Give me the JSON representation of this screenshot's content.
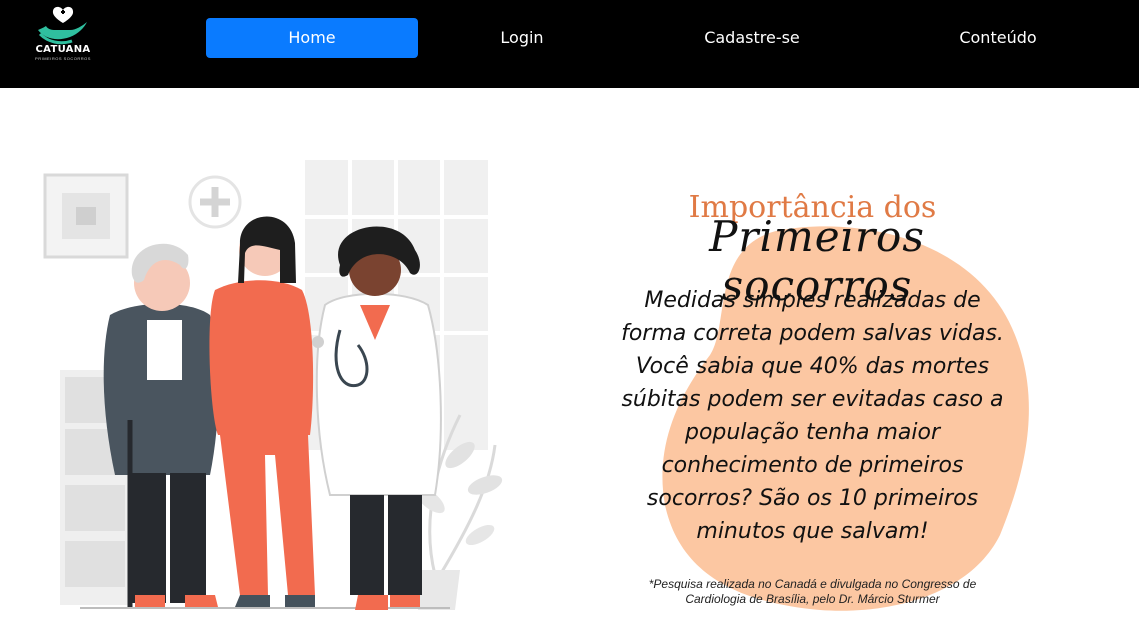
{
  "brand": {
    "name": "CATUANA",
    "tagline": "PRIMEIROS SOCORROS"
  },
  "nav": {
    "items": [
      {
        "label": "Home",
        "active": true
      },
      {
        "label": "Login",
        "active": false
      },
      {
        "label": "Cadastre-se",
        "active": false
      },
      {
        "label": "Conteúdo",
        "active": false
      }
    ]
  },
  "hero": {
    "title_line1": "Importância dos",
    "title_line2": "Primeiros socorros",
    "body": "Medidas simples realizadas de forma correta podem salvas vidas. Você sabia que 40% das mortes súbitas podem ser evitadas caso a população tenha maior conhecimento de primeiros socorros? São os 10 primeiros minutos que salvam!",
    "footnote_line1": "*Pesquisa realizada no Canadá e divulgada no Congresso de",
    "footnote_line2": "Cardiologia de Brasília, pelo Dr. Márcio Sturmer"
  },
  "colors": {
    "nav_bg": "#000000",
    "nav_active": "#0a7bff",
    "accent_orange": "#e07a45",
    "blob_peach": "#fcc7a2",
    "scrubs": "#f26b4f"
  }
}
